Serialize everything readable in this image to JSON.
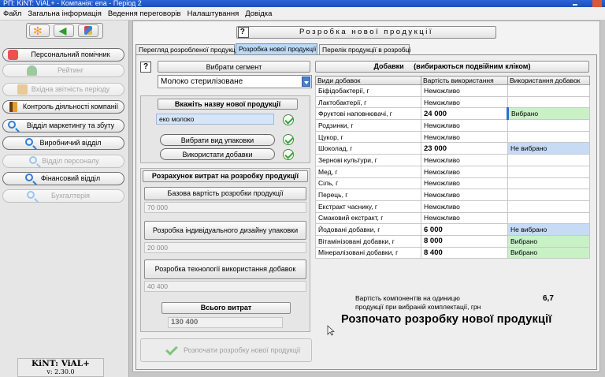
{
  "window": {
    "title": "РП: KiNT: ViAL+ - Компанія: ena - Період 2"
  },
  "menu": [
    "Файл",
    "Загальна інформація",
    "Ведення переговорів",
    "Налаштування",
    "Довідка"
  ],
  "sidebar": {
    "items": [
      {
        "label": "Персональний помічник",
        "enabled": true,
        "icon": "star-icon"
      },
      {
        "label": "Рейтинг",
        "enabled": false,
        "icon": "person-icon"
      },
      {
        "label": "Вхідна звітність періоду",
        "enabled": false,
        "icon": "report-icon"
      },
      {
        "label": "Контроль діяльності компанії",
        "enabled": true,
        "icon": "book-icon"
      },
      {
        "label": "Відділ маркетингу та збуту",
        "enabled": true,
        "icon": "search-icon"
      },
      {
        "label": "Виробничий відділ",
        "enabled": true,
        "icon": "search-icon"
      },
      {
        "label": "Відділ персоналу",
        "enabled": false,
        "icon": "search-icon"
      },
      {
        "label": "Фінансовий відділ",
        "enabled": true,
        "icon": "search-icon"
      },
      {
        "label": "Бухгалтерія",
        "enabled": false,
        "icon": "search-icon"
      }
    ],
    "version_title": "KiNT: ViAL+",
    "version": "v: 2.30.0"
  },
  "header": {
    "help": "?",
    "title": "Розробка нової продукції"
  },
  "tabs": [
    {
      "label": "Перегляд розробленої продукції",
      "active": false
    },
    {
      "label": "Розробка нової продукції",
      "active": true
    },
    {
      "label": "Перелік продукції в розробці",
      "active": false
    }
  ],
  "segment": {
    "help": "?",
    "button": "Вибрати сегмент",
    "selected": "Молоко стерилізоване"
  },
  "product": {
    "name_header": "Вкажіть назву нової продукції",
    "name_value": "еко молоко",
    "choose_packaging": "Вибрати вид упаковки",
    "use_additives": "Використати добавки"
  },
  "costs": {
    "header": "Розрахунок витрат на розробку продукції",
    "base_label": "Базова вартість розробки продукції",
    "base_value": "70 000",
    "design_label": "Розробка індивідуального дизайну упаковки",
    "design_value": "20 000",
    "tech_label": "Розробка технології використання добавок",
    "tech_value": "40 400",
    "total_label": "Всього витрат",
    "total_value": "130 400"
  },
  "start_button": "Розпочати розробку нової продукції",
  "additives": {
    "header": "Добавки     (вибираються подвійним кліком)",
    "columns": [
      "Види добавок",
      "Вартість використання",
      "Використання добавок"
    ],
    "rows": [
      {
        "name": "Біфідобактерії, г",
        "price": "Неможливо",
        "use": "",
        "state": ""
      },
      {
        "name": "Лактобактерії, г",
        "price": "Неможливо",
        "use": "",
        "state": ""
      },
      {
        "name": "Фруктові наповнювачі, г",
        "price": "24 000",
        "use": "Вибрано",
        "state": "green-cursor"
      },
      {
        "name": "Родзинки, г",
        "price": "Неможливо",
        "use": "",
        "state": ""
      },
      {
        "name": "Цукор, г",
        "price": "Неможливо",
        "use": "",
        "state": ""
      },
      {
        "name": "Шоколад, г",
        "price": "23 000",
        "use": "Не вибрано",
        "state": "blue"
      },
      {
        "name": "Зернові культури, г",
        "price": "Неможливо",
        "use": "",
        "state": ""
      },
      {
        "name": "Мед, г",
        "price": "Неможливо",
        "use": "",
        "state": ""
      },
      {
        "name": "Сіль, г",
        "price": "Неможливо",
        "use": "",
        "state": ""
      },
      {
        "name": "Перець, г",
        "price": "Неможливо",
        "use": "",
        "state": ""
      },
      {
        "name": "Екстракт часнику, г",
        "price": "Неможливо",
        "use": "",
        "state": ""
      },
      {
        "name": "Смаковий екстракт, г",
        "price": "Неможливо",
        "use": "",
        "state": ""
      },
      {
        "name": "Йодовані добавки, г",
        "price": "6 000",
        "use": "Не вибрано",
        "state": "blue"
      },
      {
        "name": "Вітамінізовані добавки, г",
        "price": "8 000",
        "use": "Вибрано",
        "state": "green"
      },
      {
        "name": "Мінералізовані добавки, г",
        "price": "8 400",
        "use": "Вибрано",
        "state": "green"
      }
    ]
  },
  "summary": {
    "label_line1": "Вартість компонентів на одиницю",
    "label_line2": "продукції при вибраній комплектації, грн",
    "value": "6,7",
    "big_title": "Розпочато розробку нової продукції"
  },
  "colors": {
    "selected_green": "#c8f2c6",
    "not_selected_blue": "#c7dbf5",
    "active_tab": "#bcd8f4"
  }
}
